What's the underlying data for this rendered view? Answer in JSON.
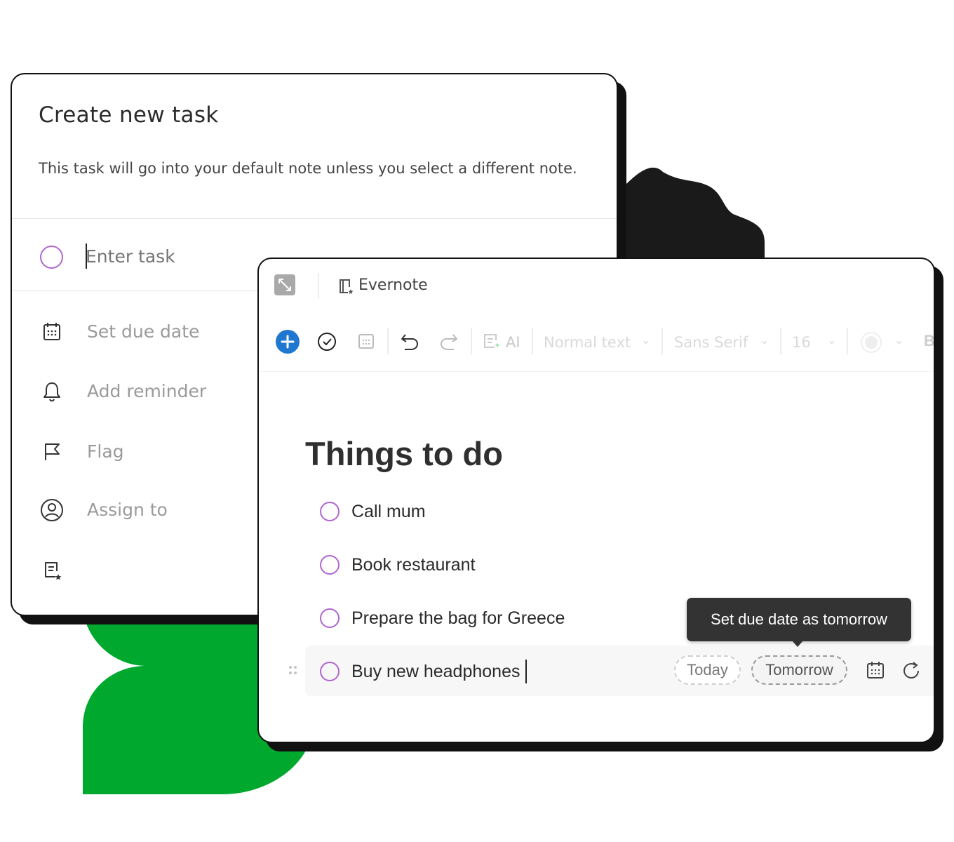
{
  "create_task": {
    "title": "Create new task",
    "subtitle": "This task will go into your default note unless you select a different note.",
    "input_placeholder": "Enter task",
    "options": [
      {
        "label": "Set due date",
        "icon": "calendar-icon"
      },
      {
        "label": "Add reminder",
        "icon": "bell-icon"
      },
      {
        "label": "Flag",
        "icon": "flag-icon"
      },
      {
        "label": "Assign to",
        "icon": "user-circle-icon"
      },
      {
        "label": "",
        "icon": "note-star-icon"
      }
    ]
  },
  "editor": {
    "app_name": "Evernote",
    "toolbar": {
      "ai_label": "AI",
      "style_select": "Normal text",
      "font_select": "Sans Serif",
      "size_select": "16"
    },
    "note": {
      "title": "Things to do",
      "tasks": [
        {
          "text": "Call mum"
        },
        {
          "text": "Book restaurant"
        },
        {
          "text": "Prepare the bag for Greece"
        },
        {
          "text": "Buy new headphones"
        }
      ]
    },
    "due_chips": {
      "today": "Today",
      "tomorrow": "Tomorrow"
    },
    "tooltip": "Set due date as tomorrow"
  },
  "colors": {
    "accent_purple": "#b266cf",
    "brand_green": "#00a82d",
    "primary_blue": "#1f77d0",
    "dark": "#1a1a1a"
  }
}
